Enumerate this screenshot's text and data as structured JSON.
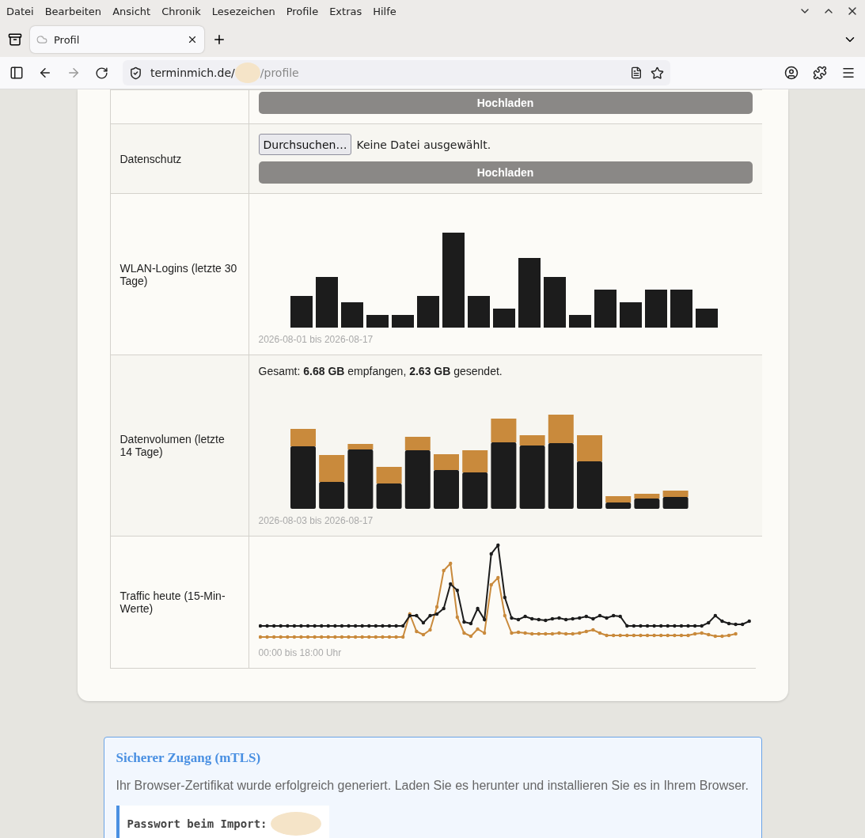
{
  "menu_bar": [
    "Datei",
    "Bearbeiten",
    "Ansicht",
    "Chronik",
    "Lesezeichen",
    "Profile",
    "Extras",
    "Hilfe"
  ],
  "tabs": [
    {
      "label": "Profil",
      "selected": true
    }
  ],
  "address_bar": {
    "url_host": "terminmich.de/",
    "url_path": "/profile"
  },
  "profile_table": {
    "rows": [
      {
        "kind": "upload-cut",
        "button": "Hochladen"
      },
      {
        "kind": "upload",
        "label": "Datenschutz",
        "browse_button": "Durchsuchen…",
        "file_status": "Keine Datei ausgewählt.",
        "button": "Hochladen"
      },
      {
        "kind": "logins",
        "label": "WLAN-Logins (letzte 30 Tage)",
        "caption": "2026-08-01 bis 2026-08-17"
      },
      {
        "kind": "volume",
        "label": "Datenvolumen (letzte 14 Tage)",
        "summary": "Gesamt: **6.68 GB** empfangen, **2.63 GB** gesendet.",
        "caption": "2026-08-03 bis 2026-08-17"
      },
      {
        "kind": "traffic",
        "label": "Traffic heute (15-Min-Werte)",
        "caption": "00:00 bis 18:00 Uhr"
      }
    ]
  },
  "mtls_box": {
    "title": "Sicherer Zugang (mTLS)",
    "text": "Ihr Browser-Zertifikat wurde erfolgreich generiert. Laden Sie es herunter und installieren Sie es in Ihrem Browser.",
    "password_label": "Passwort beim Import:"
  }
}
